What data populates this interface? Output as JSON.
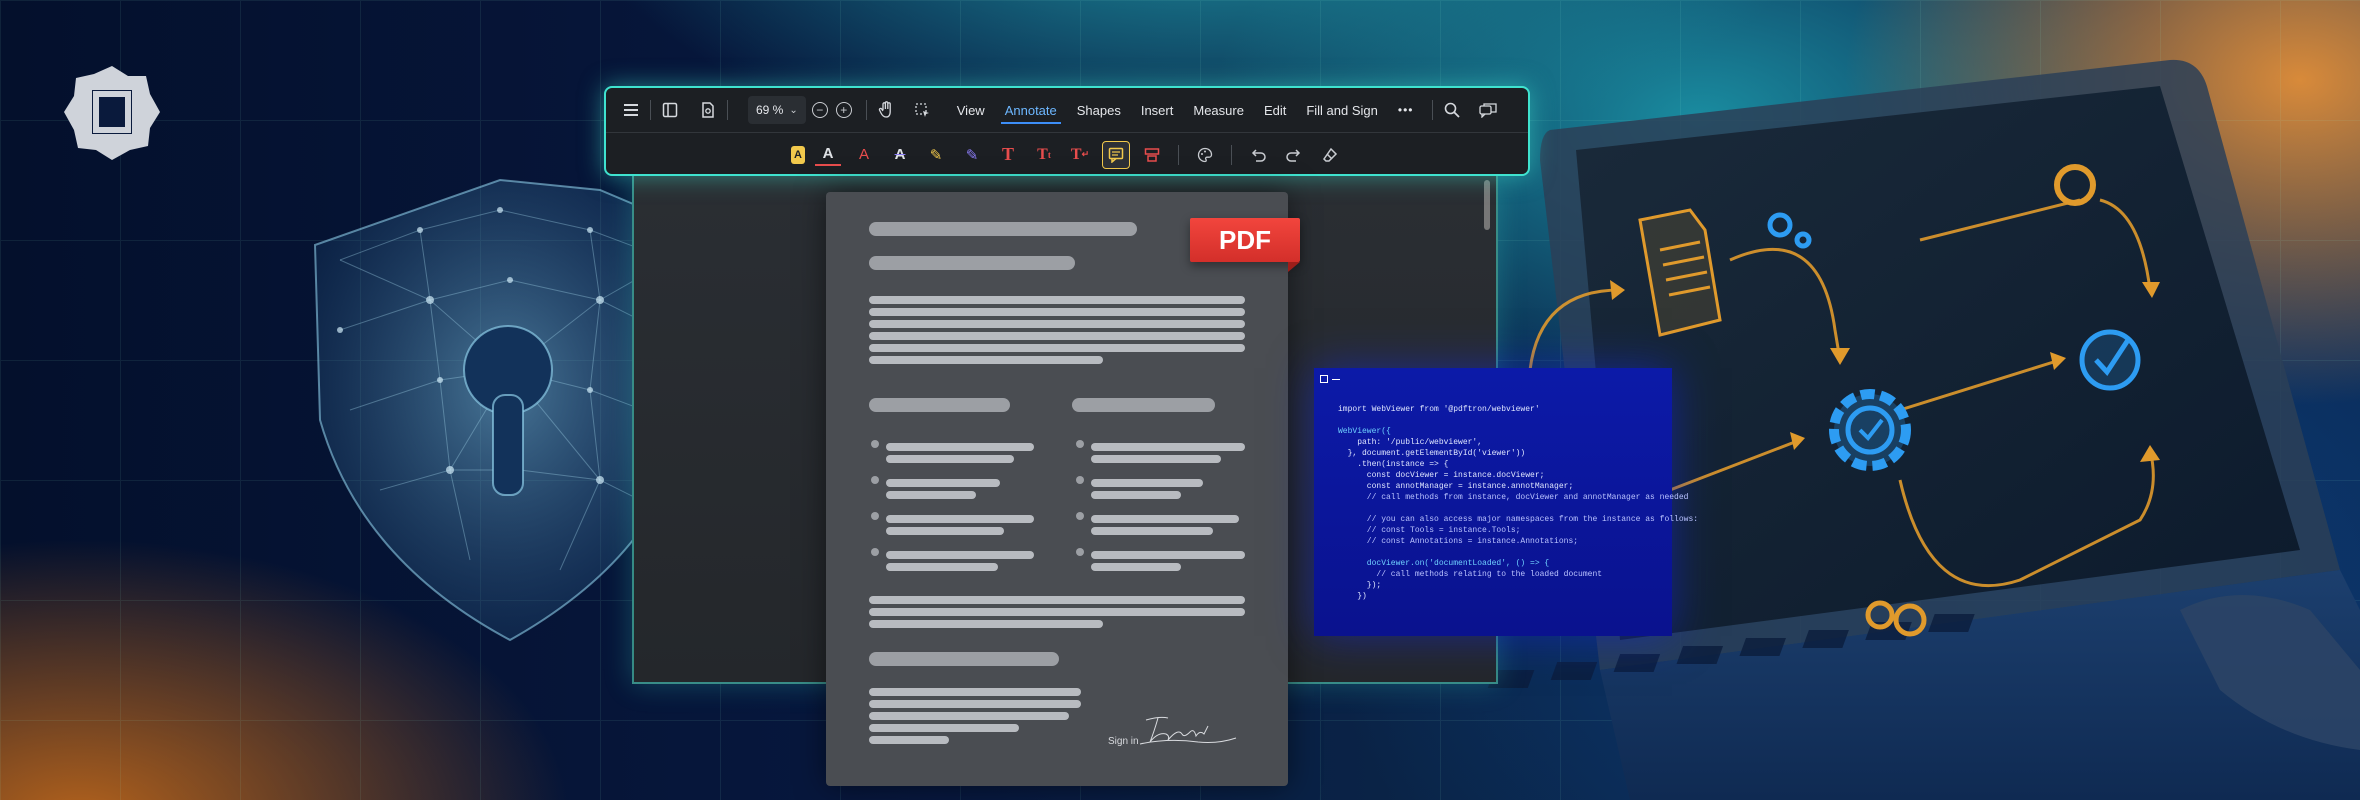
{
  "toolbar": {
    "zoom_value": "69 %",
    "tabs": [
      {
        "label": "View",
        "active": false
      },
      {
        "label": "Annotate",
        "active": true
      },
      {
        "label": "Shapes",
        "active": false
      },
      {
        "label": "Insert",
        "active": false
      },
      {
        "label": "Measure",
        "active": false
      },
      {
        "label": "Edit",
        "active": false
      },
      {
        "label": "Fill and Sign",
        "active": false
      }
    ],
    "more_label": "•••",
    "accent_color": "#3fe3cf",
    "active_tab_color": "#3d8ef7"
  },
  "document": {
    "pdf_badge": "PDF",
    "sign_in_label": "Sign in"
  },
  "code": {
    "lines": [
      "import WebViewer from '@pdftron/webviewer'",
      "",
      "WebViewer({",
      "    path: '/public/webviewer',",
      "  }, document.getElementById('viewer'))",
      "    .then(instance => {",
      "      const docViewer = instance.docViewer;",
      "      const annotManager = instance.annotManager;",
      "      // call methods from instance, docViewer and annotManager as needed",
      "",
      "      // you can also access major namespaces from the instance as follows:",
      "      // const Tools = instance.Tools;",
      "      // const Annotations = instance.Annotations;",
      "",
      "      docViewer.on('documentLoaded', () => {",
      "        // call methods relating to the loaded document",
      "      });",
      "    })"
    ]
  }
}
